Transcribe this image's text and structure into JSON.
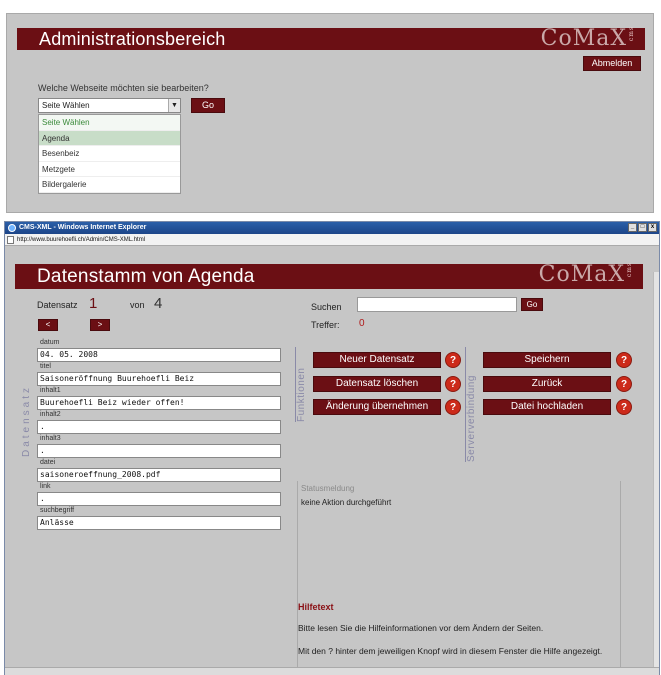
{
  "admin": {
    "title": "Administrationsbereich",
    "logo": "CoMaX",
    "logo_tm": "cms",
    "logout_label": "Abmelden",
    "question": "Welche Webseite möchten sie bearbeiten?",
    "select_value": "Seite Wählen",
    "go_label": "Go",
    "dropdown_options": [
      "Seite Wählen",
      "Agenda",
      "Besenbeiz",
      "Metzgete",
      "Bildergalerie"
    ]
  },
  "ie": {
    "window_title": "CMS-XML - Windows Internet Explorer",
    "address": "http://www.buurehoefli.ch/Admin/CMS-XML.html",
    "controls": [
      "_",
      "□",
      "x"
    ]
  },
  "record": {
    "title": "Datenstamm von Agenda",
    "logo": "CoMaX",
    "logo_tm": "cms",
    "record_label": "Datensatz",
    "record_num": "1",
    "von_label": "von",
    "record_total": "4",
    "prev_label": "<",
    "next_label": ">",
    "side_label": "Datensatz",
    "fields": [
      {
        "label": "datum",
        "value": "04. 05. 2008"
      },
      {
        "label": "titel",
        "value": "Saisoneröffnung Buurehoefli Beiz"
      },
      {
        "label": "inhalt1",
        "value": "Buurehoefli Beiz wieder offen!"
      },
      {
        "label": "inhalt2",
        "value": "."
      },
      {
        "label": "inhalt3",
        "value": "."
      },
      {
        "label": "datei",
        "value": "saisoneroeffnung_2008.pdf"
      },
      {
        "label": "link",
        "value": "."
      },
      {
        "label": "suchbegriff",
        "value": "Anlässe"
      }
    ]
  },
  "search": {
    "label": "Suchen",
    "value": "",
    "go_label": "Go",
    "hits_label": "Treffer:",
    "hits_count": "0"
  },
  "functions": {
    "section_label": "Funktionen",
    "new_record": "Neuer Datensatz",
    "delete_record": "Datensatz löschen",
    "apply_change": "Änderung übernehmen",
    "help_q": "?"
  },
  "server": {
    "section_label": "Serververbindung",
    "save": "Speichern",
    "back": "Zurück",
    "upload": "Datei hochladen"
  },
  "status": {
    "title": "Statusmeldung",
    "text": "keine Aktion durchgeführt"
  },
  "help": {
    "title": "Hilfetext",
    "text1": "Bitte lesen Sie die Hilfeinformationen vor dem Ändern der Seiten.",
    "text2": "Mit den ? hinter dem jeweiligen Knopf wird in diesem Fenster die Hilfe angezeigt."
  },
  "colors": {
    "brand": "#6b0f14",
    "help_icon": "#cc2a1a",
    "panel_bg": "#c6c6c6"
  }
}
